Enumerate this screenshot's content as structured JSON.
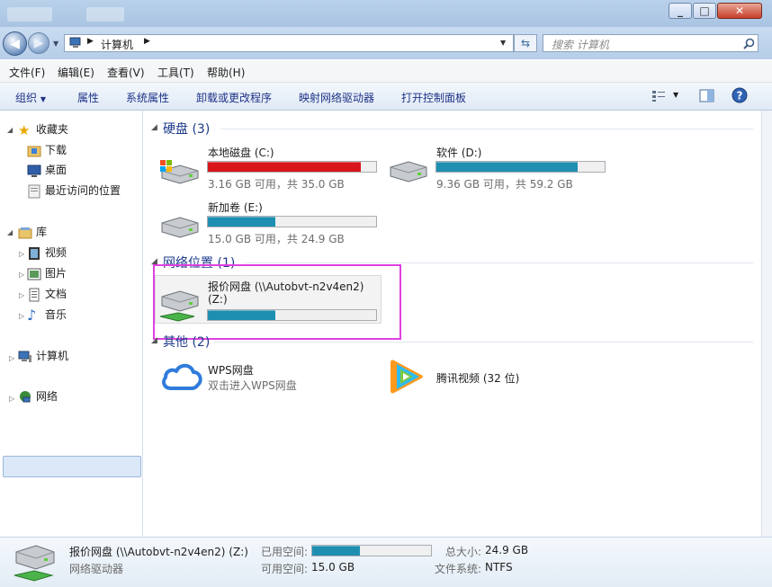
{
  "window": {
    "address_path": [
      "计算机"
    ],
    "search_placeholder": "搜索 计算机"
  },
  "menu": [
    "文件(F)",
    "编辑(E)",
    "查看(V)",
    "工具(T)",
    "帮助(H)"
  ],
  "commands": [
    "组织",
    "属性",
    "系统属性",
    "卸载或更改程序",
    "映射网络驱动器",
    "打开控制面板"
  ],
  "nav": {
    "favorites": "收藏夹",
    "downloads": "下载",
    "desktop": "桌面",
    "recent": "最近访问的位置",
    "libraries": "库",
    "videos": "视频",
    "pictures": "图片",
    "documents": "文档",
    "music": "音乐",
    "computer": "计算机",
    "network": "网络"
  },
  "groups": {
    "hard_disks": "硬盘 (3)",
    "network_locations": "网络位置 (1)",
    "other": "其他 (2)"
  },
  "drives": [
    {
      "label": "本地磁盘 (C:)",
      "info": "3.16 GB 可用，共 35.0 GB",
      "used_fraction": 0.91,
      "bar_color": "#d9141b"
    },
    {
      "label": "软件 (D:)",
      "info": "9.36 GB 可用，共 59.2 GB",
      "used_fraction": 0.84,
      "bar_color": "#1e8fb0"
    },
    {
      "label": "新加卷 (E:)",
      "info": "15.0 GB 可用，共 24.9 GB",
      "used_fraction": 0.4,
      "bar_color": "#1e8fb0"
    }
  ],
  "network_drive": {
    "label_line1": "报价网盘 (\\\\Autobvt-n2v4en2)",
    "label_line2": "(Z:)",
    "used_fraction": 0.4
  },
  "other_items": [
    {
      "name": "WPS网盘",
      "sub": "双击进入WPS网盘"
    },
    {
      "name": "腾讯视频 (32 位)"
    }
  ],
  "details": {
    "title": "报价网盘 (\\\\Autobvt-n2v4en2) (Z:)",
    "type": "网络驱动器",
    "used_label": "已用空间:",
    "free_label": "可用空间:",
    "free_value": "15.0 GB",
    "total_label": "总大小:",
    "total_value": "24.9 GB",
    "fs_label": "文件系统:",
    "fs_value": "NTFS",
    "used_fraction": 0.4
  }
}
